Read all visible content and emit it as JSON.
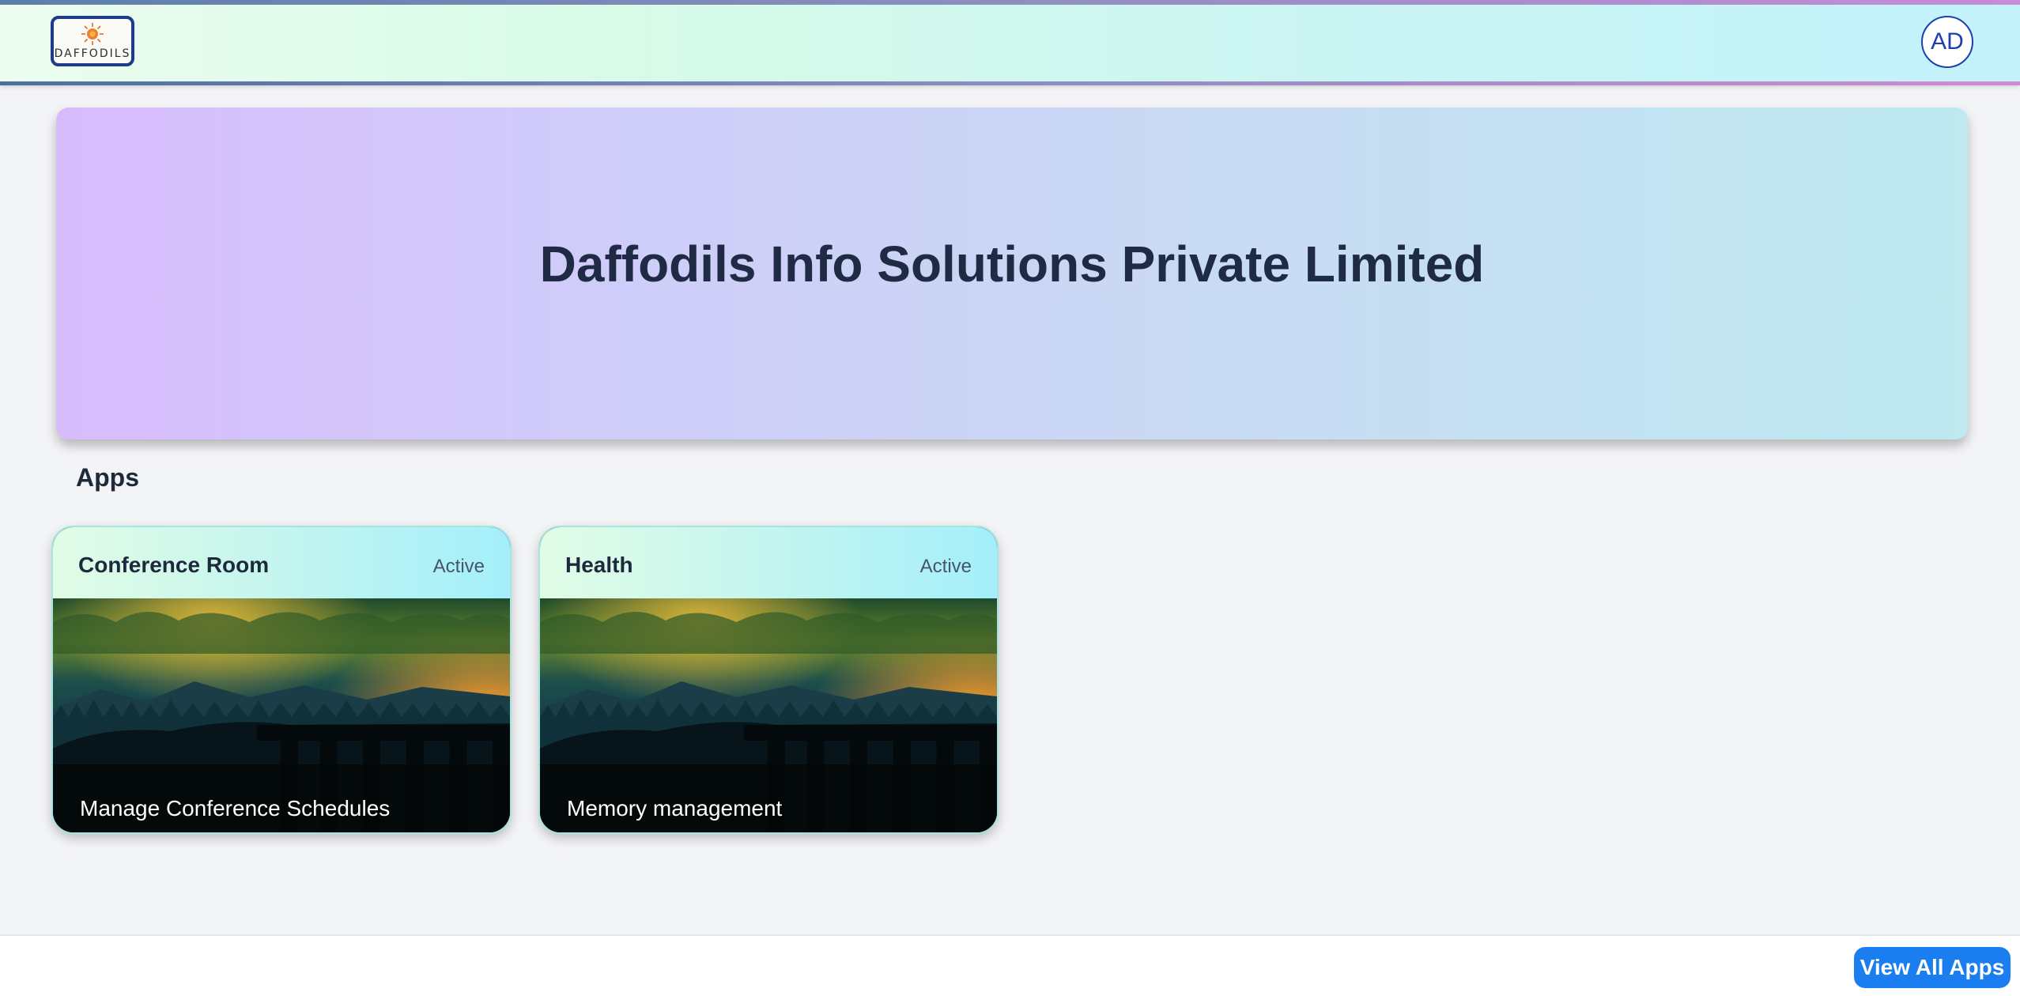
{
  "header": {
    "logo_text": "DAFFODILS",
    "avatar_initials": "AD"
  },
  "banner": {
    "title": "Daffodils Info Solutions Private Limited"
  },
  "apps_section": {
    "title": "Apps",
    "cards": [
      {
        "title": "Conference Room",
        "status": "Active",
        "description": "Manage Conference Schedules"
      },
      {
        "title": "Health",
        "status": "Active",
        "description": "Memory management"
      }
    ]
  },
  "footer": {
    "view_all_label": "View All Apps"
  },
  "colors": {
    "accent": "#1a7ef0",
    "avatar": "#1e40af",
    "logo_border": "#1e3a8a"
  },
  "icons": {
    "logo": "daffodils-sun-logo",
    "card_image": "night-forest-landscape"
  }
}
